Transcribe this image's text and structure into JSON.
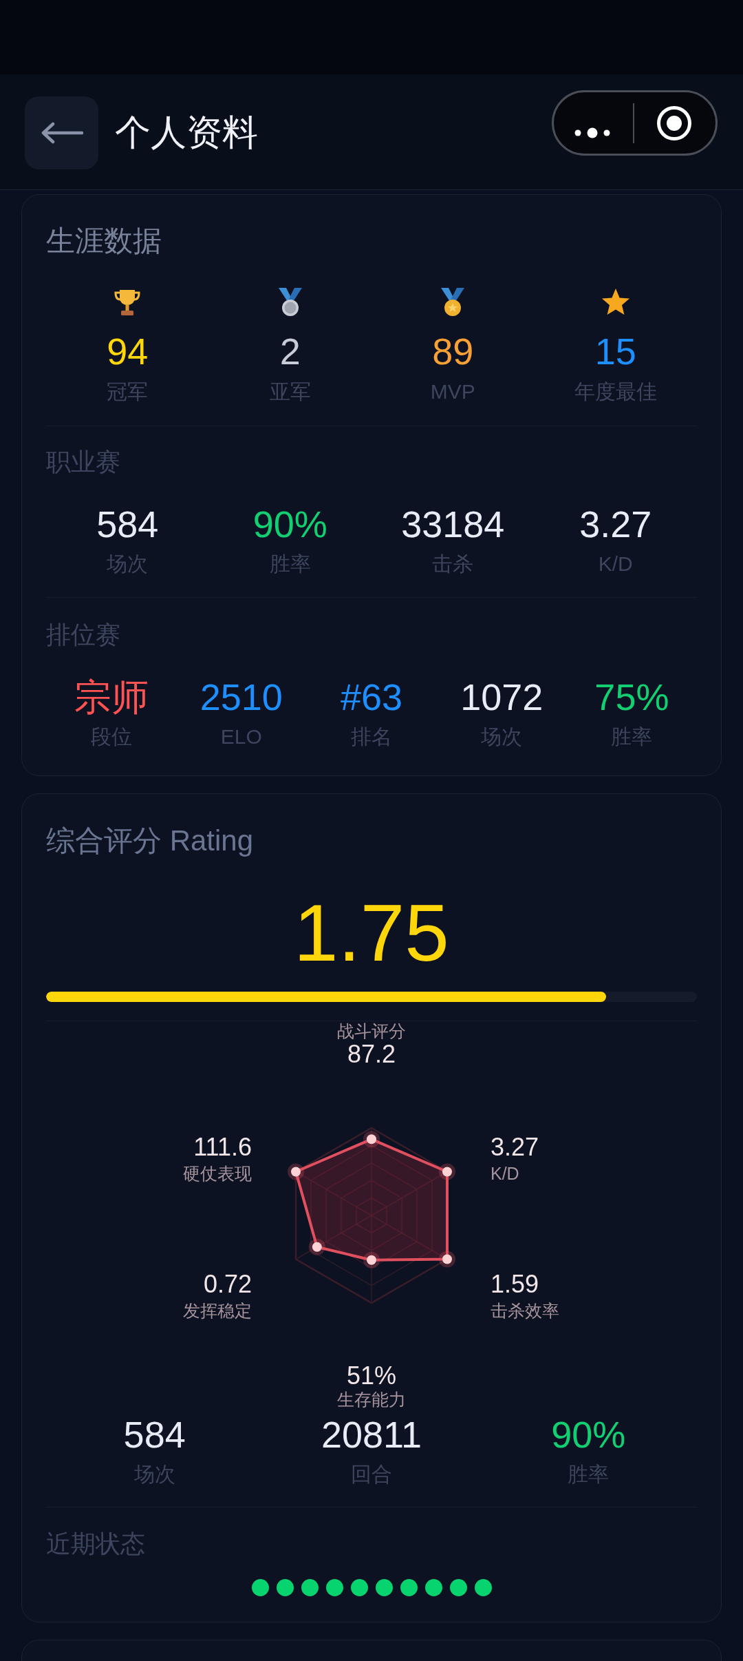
{
  "header": {
    "title": "个人资料"
  },
  "career": {
    "title": "生涯数据",
    "awards": [
      {
        "kind": "trophy",
        "value": "94",
        "label": "冠军",
        "color": "#ffd60a"
      },
      {
        "kind": "silver_medal",
        "value": "2",
        "label": "亚军",
        "color": "#c8ccd8"
      },
      {
        "kind": "medal",
        "value": "89",
        "label": "MVP",
        "color": "#f7a035"
      },
      {
        "kind": "star",
        "value": "15",
        "label": "年度最佳",
        "color": "#1e8fff"
      }
    ],
    "sections": [
      {
        "title": "职业赛",
        "stats": [
          {
            "value": "584",
            "label": "场次",
            "color": "#e8ecf6"
          },
          {
            "value": "90%",
            "label": "胜率",
            "color": "#12d072"
          },
          {
            "value": "33184",
            "label": "击杀",
            "color": "#e8ecf6"
          },
          {
            "value": "3.27",
            "label": "K/D",
            "color": "#e8ecf6"
          }
        ]
      },
      {
        "title": "排位赛",
        "stats": [
          {
            "value": "宗师",
            "label": "段位",
            "color": "#ff5252"
          },
          {
            "value": "2510",
            "label": "ELO",
            "color": "#1e8fff"
          },
          {
            "value": "#63",
            "label": "排名",
            "color": "#1e8fff"
          },
          {
            "value": "1072",
            "label": "场次",
            "color": "#e8ecf6"
          },
          {
            "value": "75%",
            "label": "胜率",
            "color": "#12d072"
          }
        ]
      }
    ]
  },
  "rating": {
    "title": "综合评分 Rating",
    "score": "1.75",
    "level": 0.86,
    "radar": {
      "axes": [
        {
          "label": "战斗评分",
          "value": "87.2"
        },
        {
          "label": "硬仗表现",
          "value": "111.6"
        },
        {
          "label": "K/D",
          "value": "3.27"
        },
        {
          "label": "发挥稳定",
          "value": "0.72"
        },
        {
          "label": "击杀效率",
          "value": "1.59"
        },
        {
          "label": "生存能力",
          "value": "51%"
        }
      ]
    },
    "stats": [
      {
        "value": "584",
        "label": "场次",
        "color": "#e8ecf6"
      },
      {
        "value": "20811",
        "label": "回合",
        "color": "#e8ecf6"
      },
      {
        "value": "90%",
        "label": "胜率",
        "color": "#12d072"
      }
    ],
    "recent_form": {
      "title": "近期状态",
      "results": [
        {
          "color": "#07d46e"
        },
        {
          "color": "#07d46e"
        },
        {
          "color": "#07d46e"
        },
        {
          "color": "#07d46e"
        },
        {
          "color": "#07d46e"
        },
        {
          "color": "#07d46e"
        },
        {
          "color": "#07d46e"
        },
        {
          "color": "#07d46e"
        },
        {
          "color": "#07d46e"
        },
        {
          "color": "#07d46e"
        }
      ]
    }
  }
}
